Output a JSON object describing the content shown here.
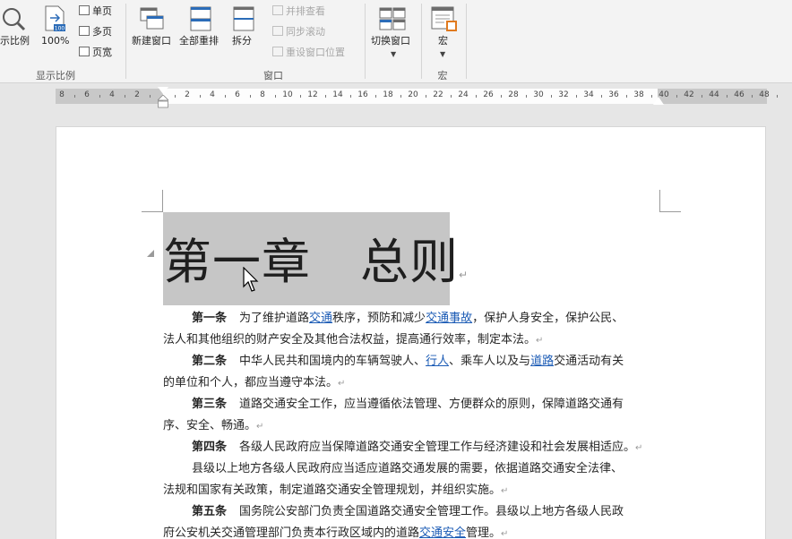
{
  "ribbon": {
    "zoom_label": "示比例",
    "zoom100_label": "100%",
    "one_page": "单页",
    "multi_page": "多页",
    "page_width": "页宽",
    "group_zoom": "显示比例",
    "new_window": "新建窗口",
    "arrange_all": "全部重排",
    "split": "拆分",
    "side_by_side": "并排查看",
    "sync_scroll": "同步滚动",
    "reset_position": "重设窗口位置",
    "group_window": "窗口",
    "switch_windows": "切换窗口",
    "macros": "宏",
    "group_macros": "宏",
    "hundred_badge": "100"
  },
  "ruler": {
    "numbers": [
      "8",
      "6",
      "4",
      "2",
      "2",
      "4",
      "6",
      "8",
      "10",
      "12",
      "14",
      "16",
      "18",
      "20",
      "22",
      "24",
      "26",
      "28",
      "30",
      "32",
      "34",
      "36",
      "38",
      "40",
      "42",
      "44",
      "46",
      "48"
    ]
  },
  "document": {
    "heading": "第一章　总则",
    "para_mark": "↵",
    "a1_title": "第一条",
    "a1_t1": "为了维护道路",
    "a1_l1": "交通",
    "a1_t2": "秩序，预防和减少",
    "a1_l2": "交通事故",
    "a1_t3": "，保护人身安全，保护公民、",
    "a1_line2": "法人和其他组织的财产安全及其他合法权益，提高通行效率，制定本法。",
    "a2_title": "第二条",
    "a2_t1": "中华人民共和国境内的车辆驾驶人、",
    "a2_l1": "行人",
    "a2_t2": "、乘车人以及与",
    "a2_l2": "道路",
    "a2_t3": "交通活动有关",
    "a2_line2": "的单位和个人，都应当遵守本法。",
    "a3_title": "第三条",
    "a3_t1": "道路交通安全工作，应当遵循依法管理、方便群众的原则，保障道路交通有",
    "a3_line2": "序、安全、畅通。",
    "a4_title": "第四条",
    "a4_t1": "各级人民政府应当保障道路交通安全管理工作与经济建设和社会发展相适应。",
    "a4_p2_line1": "县级以上地方各级人民政府应当适应道路交通发展的需要，依据道路交通安全法律、",
    "a4_p2_line2": "法规和国家有关政策，制定道路交通安全管理规划，并组织实施。",
    "a5_title": "第五条",
    "a5_t1": "国务院公安部门负责全国道路交通安全管理工作。县级以上地方各级人民政",
    "a5_t2": "府公安机关交通管理部门负责本行政区域内的道路",
    "a5_l1": "交通安全",
    "a5_t3": "管理。"
  },
  "colors": {
    "link": "#1b5bb5",
    "selection": "#c6c6c6",
    "ribbon_bg": "#f3f3f3",
    "icon_blue": "#2b6cb8"
  }
}
